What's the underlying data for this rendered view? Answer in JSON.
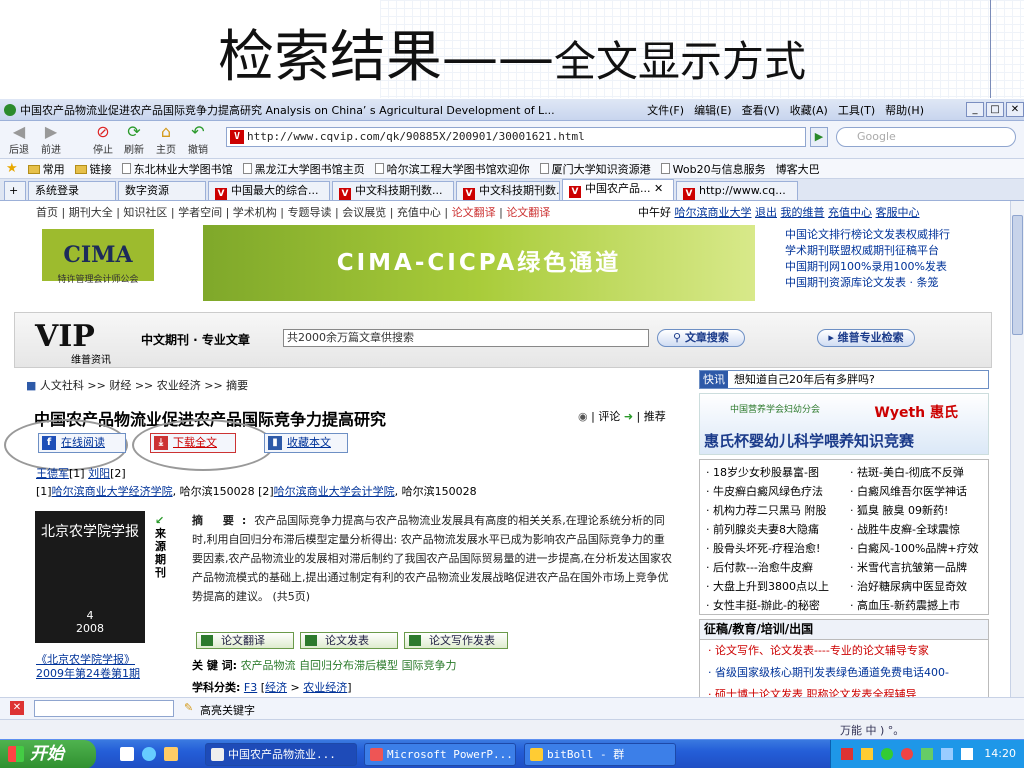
{
  "slide": {
    "title_main": "检索结果",
    "title_dash": "——",
    "title_tail": "全文显示方式"
  },
  "browser": {
    "window_title": "中国农产品物流业促进农产品国际竞争力提高研究 Analysis on China’ s Agricultural Development of L...",
    "menu": [
      "文件(F)",
      "编辑(E)",
      "查看(V)",
      "收藏(A)",
      "工具(T)",
      "帮助(H)"
    ],
    "toolbar": [
      "后退",
      "前进",
      "停止",
      "刷新",
      "主页",
      "撤销"
    ],
    "address": "http://www.cqvip.com/qk/90885X/200901/30001621.html",
    "search_placeholder": "Google",
    "favorites": [
      "常用",
      "链接",
      "东北林业大学图书馆",
      "黑龙江大学图书馆主页",
      "哈尔滨工程大学图书馆欢迎你",
      "厦门大学知识资源港",
      "Wob20与信息服务",
      "博客大巴"
    ],
    "tabs": [
      "系统登录",
      "数字资源",
      "中国最大的综合...",
      "中文科技期刊数...",
      "中文科技期刊数...",
      "中国农产品...",
      "http://www.cq..."
    ]
  },
  "site": {
    "nav_left": "首页 | 期刊大全 | 知识社区 | 学者空间 | 学术机构 | 专题导读 | 会议展览 | 充值中心 |",
    "nav_red1": "论文翻译",
    "nav_red2": "论文翻译",
    "greeting": "中午好",
    "nav_links": [
      "哈尔滨商业大学",
      "退出",
      "我的维普",
      "充值中心",
      "客服中心"
    ],
    "cima_logo": "CIMA",
    "cima_sub": "特许管理会计师公会",
    "banner_text": "CIMA-CICPA绿色通道",
    "promo": [
      "中国论文排行榜论文发表权威排行",
      "学术期刊联盟权威期刊征稿平台",
      "中国期刊网100%录用100%发表",
      "中国期刊资源库论文发表 · 条笼"
    ],
    "vip_logo": "VIP",
    "vip_sub": "维普资讯",
    "search_label": "中文期刊 · 专业文章",
    "search_value": "共2000余万篇文章供搜索",
    "search_button": "文章搜索",
    "pro_button": "维普专业检索"
  },
  "article": {
    "breadcrumb": "人文社科 >> 财经 >> 农业经济 >> 摘要",
    "title": "中国农产品物流业促进农产品国际竞争力提高研究",
    "comment": "评论",
    "recommend": "推荐",
    "btn_read": "在线阅读",
    "btn_download": "下载全文",
    "btn_collect": "收藏本文",
    "author1": "王德军",
    "author1_ref": "[1]",
    "author2": "刘阳",
    "author2_ref": "[2]",
    "affil_1_mark": "[1]",
    "affil_1": "哈尔滨商业大学经济学院",
    "affil_1_tail": ", 哈尔滨150028",
    "affil_2_mark": "[2]",
    "affil_2": "哈尔滨商业大学会计学院",
    "affil_2_tail": ", 哈尔滨150028",
    "cover_title": "北京农学院学报",
    "cover_no": "4",
    "cover_year": "2008",
    "source_label": "来源期刊",
    "journal": "《北京农学院学报》",
    "issue": "2009年第24卷第1期",
    "abstract_label": "摘 要:",
    "abstract": "农产品国际竞争力提高与农产品物流业发展具有高度的相关关系,在理论系统分析的同时,利用自回归分布滞后模型定量分析得出: 农产品物流发展水平已成为影响农产品国际竞争力的重要因素,农产品物流业的发展相对滞后制约了我国农产品国际贸易量的进一步提高,在分析发达国家农产品物流模式的基础上,提出通过制定有利的农产品物流业发展战略促进农产品在国外市场上竞争优势提高的建议。 (共5页)",
    "tags": [
      "论文翻译",
      "论文发表",
      "论文写作发表"
    ],
    "keywords_label": "关 键 词:",
    "keywords": [
      "农产品物流",
      "自回归分布滞后模型",
      "国际竞争力"
    ],
    "class_label": "学科分类:",
    "class_code": "F3",
    "class_path": [
      "经济",
      "农业经济"
    ]
  },
  "sidebar": {
    "quick_label": "快讯",
    "quick_text": "想知道自己20年后有多胖吗?",
    "ad_org": "中国营养学会妇幼分会",
    "ad_brand": "Wyeth 惠氏",
    "ad_title": "惠氏杯婴幼儿科学喂养知识竞赛",
    "links_left": [
      "· 18岁少女秒股暴富-图",
      "· 牛皮癣白癜风绿色疗法",
      "· 机构力荐二只黑马 附股",
      "· 前列腺炎夫妻8大隐痛",
      "· 股骨头坏死-疗程治愈!",
      "· 后付款---治愈牛皮癣",
      "· 大盘上升到3800点以上",
      "· 女性丰挺-辦此-的秘密"
    ],
    "links_right": [
      "· 祛斑-美白-彻底不反弹",
      "· 白癜风维吾尔医学神话",
      "· 狐臭 腋臭 09新药!",
      "· 战胜牛皮癣-全球震惊",
      "· 白癜风-100%品牌+疗效",
      "· 米雪代言抗皱第一品牌",
      "· 治好糖尿病中医显奇效",
      "· 高血压-新药震撼上市"
    ],
    "section_title": "征稿/教育/培训/出国",
    "section_items": [
      "· 论文写作、论文发表----专业的论文辅导专家",
      "· 省级国家级核心期刊发表绿色通道免费电话400-",
      "· 硕士博士论文发表 职称论文发表全程辅导"
    ]
  },
  "footer": {
    "find_label": "高亮关键字",
    "start": "开始",
    "tasks": [
      "中国农产品物流业...",
      "Microsoft PowerP...",
      "bitBoll - 群"
    ],
    "clock": "14:20",
    "status_text": "万能 中 ) °。"
  }
}
